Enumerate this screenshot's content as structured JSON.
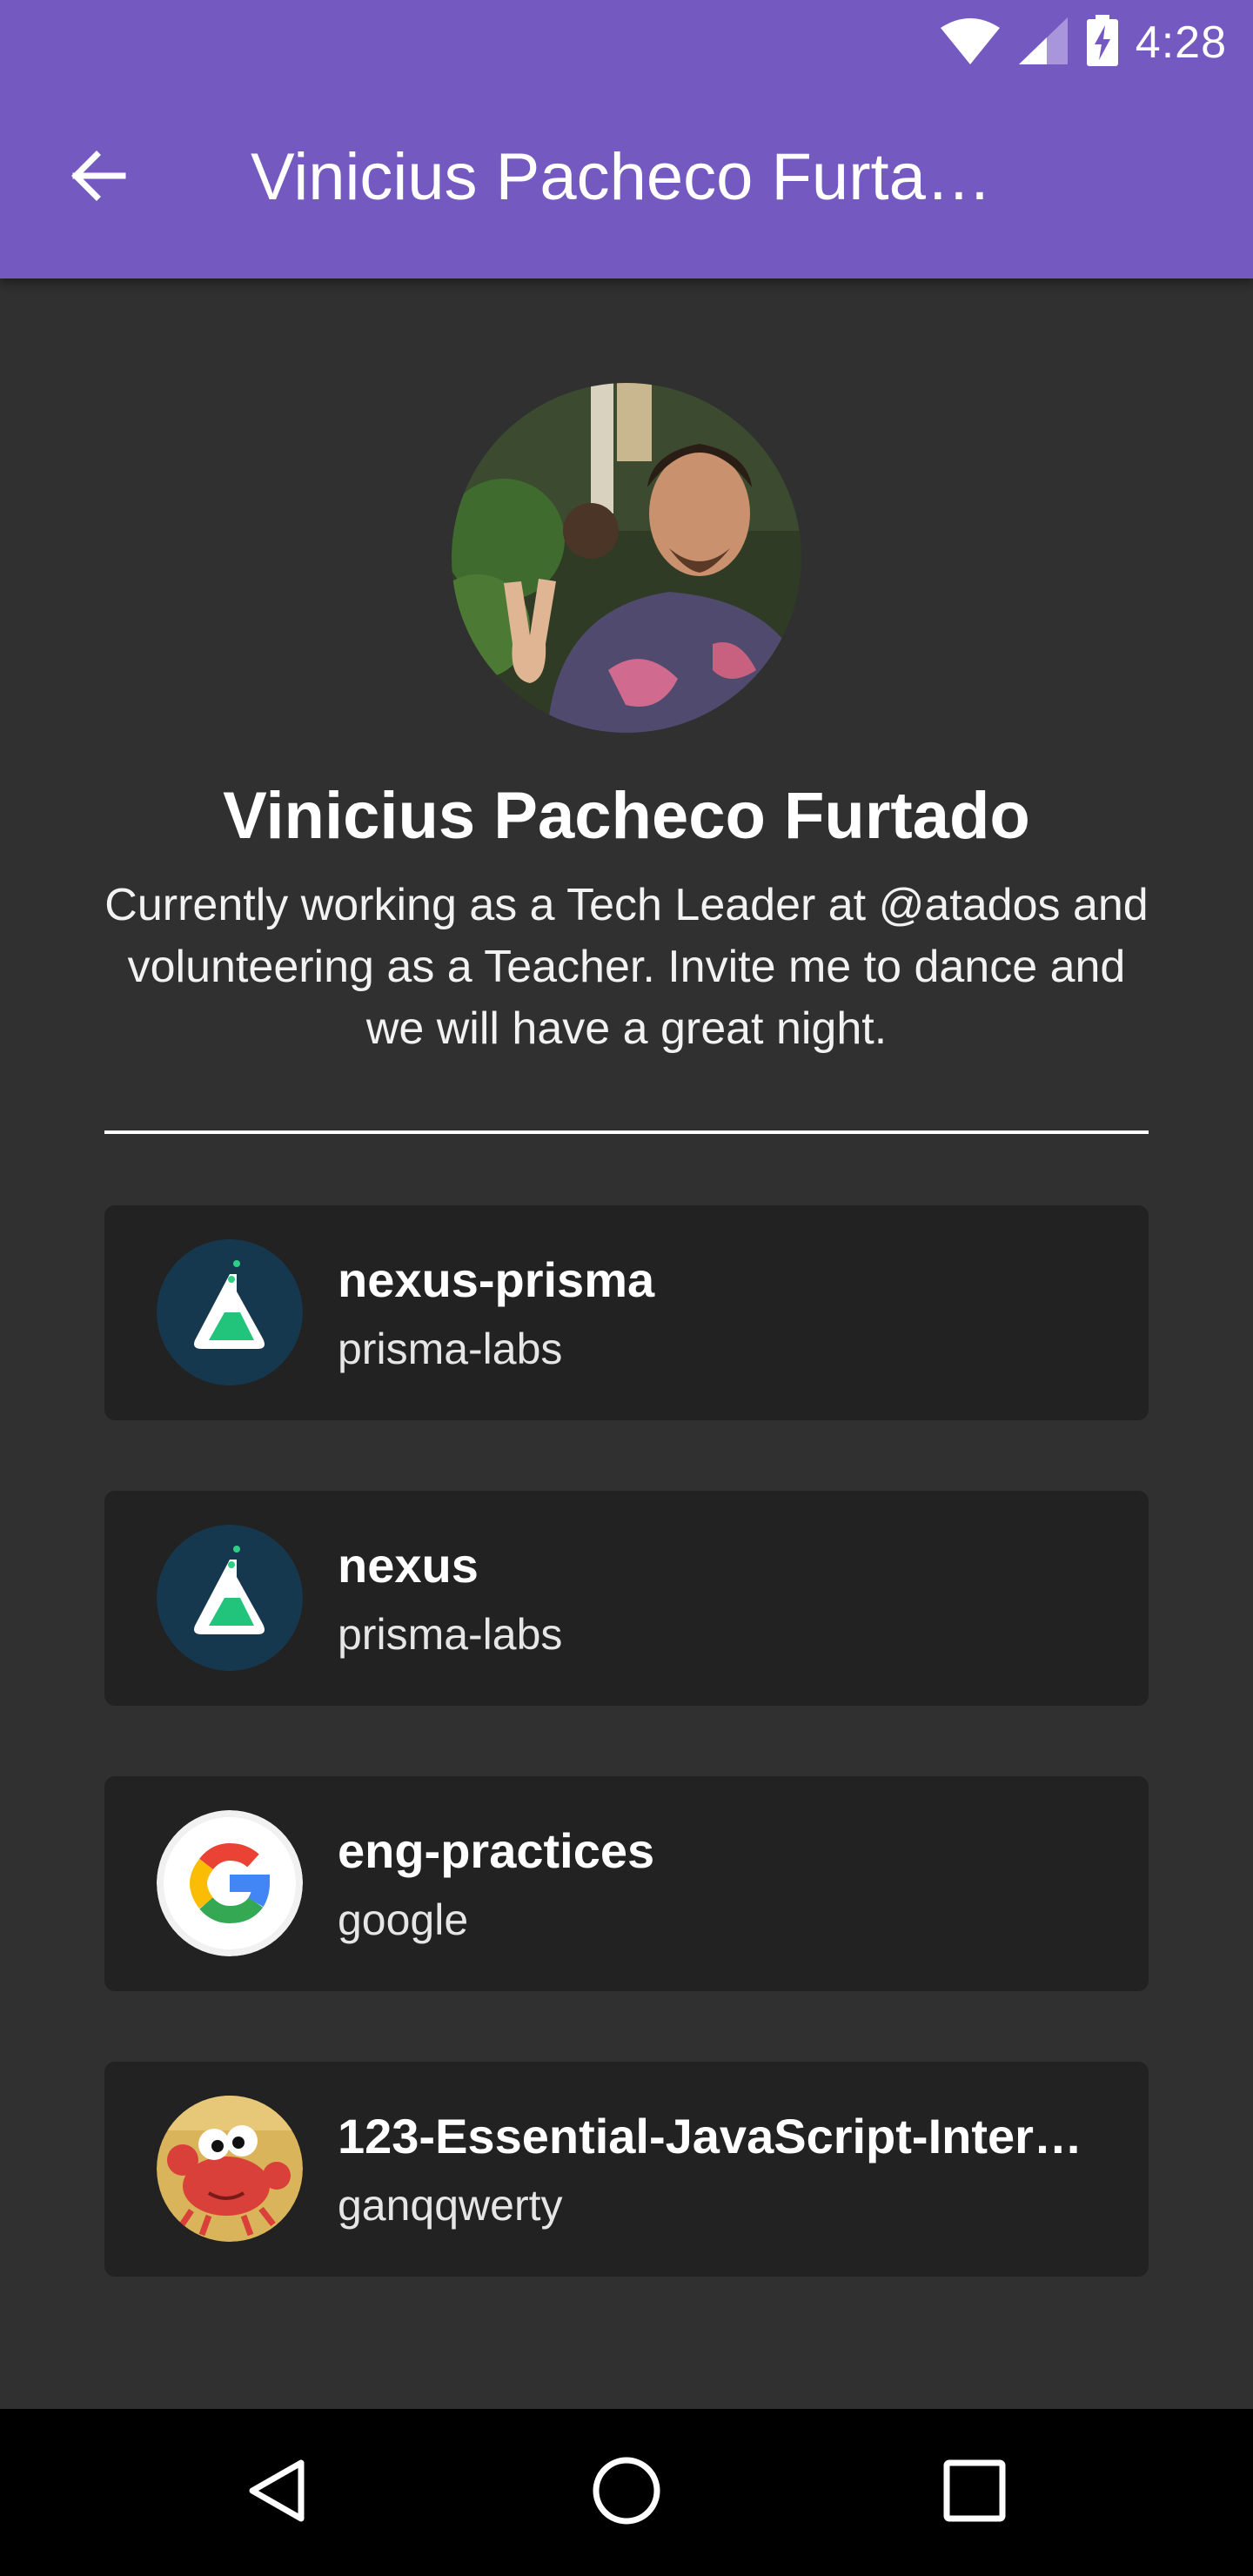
{
  "status_bar": {
    "time": "4:28",
    "icons": [
      "wifi-icon",
      "cell-signal-icon",
      "battery-charging-icon"
    ]
  },
  "app_bar": {
    "back_icon": "arrow-back-icon",
    "title": "Vinicius Pacheco Furta…"
  },
  "profile": {
    "name": "Vinicius Pacheco Furtado",
    "bio": "Currently working as a Tech Leader at @atados and volunteering as a Teacher. Invite me to dance and we will have a great night."
  },
  "repos": [
    {
      "name": "nexus-prisma",
      "owner": "prisma-labs",
      "icon": "prisma-labs-logo-icon"
    },
    {
      "name": "nexus",
      "owner": "prisma-labs",
      "icon": "prisma-labs-logo-icon"
    },
    {
      "name": "eng-practices",
      "owner": "google",
      "icon": "google-logo-icon"
    },
    {
      "name": "123-Essential-JavaScript-Inter…",
      "owner": "ganqqwerty",
      "icon": "crab-avatar-icon"
    }
  ],
  "nav_bar": {
    "buttons": [
      "back-triangle-icon",
      "home-circle-icon",
      "recents-square-icon"
    ]
  },
  "colors": {
    "app_bar": "#7459c1",
    "background": "#303030",
    "card": "#222222",
    "nav_bar": "#000000"
  }
}
